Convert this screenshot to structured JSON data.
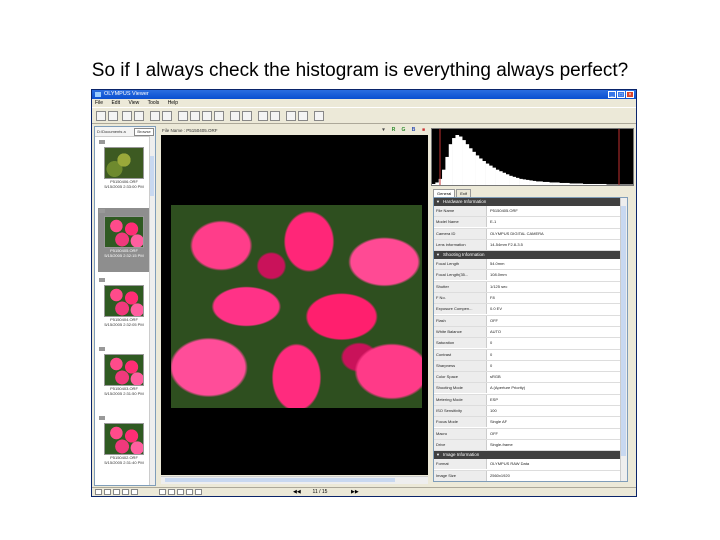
{
  "slide": {
    "title": "So if I always check the histogram is everything always perfect?"
  },
  "window": {
    "title": "OLYMPUS Viewer",
    "controls": [
      "_",
      "□",
      "×"
    ]
  },
  "menu": [
    "File",
    "Edit",
    "View",
    "Tools",
    "Help"
  ],
  "left_panel": {
    "path": "D:\\Documents a",
    "browse_label": "Browse",
    "thumbnails": [
      {
        "name": "P5150406.ORF",
        "date": "5/15/2005 2:33:00 PM",
        "image": "green",
        "selected": false
      },
      {
        "name": "P5150405.ORF",
        "date": "5/15/2005 2:32:15 PM",
        "image": "flower",
        "selected": true
      },
      {
        "name": "P5150404.ORF",
        "date": "5/15/2005 2:32:05 PM",
        "image": "flower",
        "selected": false
      },
      {
        "name": "P5150403.ORF",
        "date": "5/15/2005 2:31:50 PM",
        "image": "flower",
        "selected": false
      },
      {
        "name": "P5150402.ORF",
        "date": "5/15/2005 2:31:40 PM",
        "image": "flower",
        "selected": false
      }
    ]
  },
  "center": {
    "file_label": "File Name : P5150405.ORF",
    "pager": "11 / 15"
  },
  "right_panel": {
    "tabs": [
      "General",
      "Exif"
    ],
    "sections": [
      {
        "title": "Hardware Information",
        "rows": [
          {
            "k": "File Name",
            "v": "P5150405.ORF"
          },
          {
            "k": "Model Name",
            "v": "E-1"
          },
          {
            "k": "Camera ID",
            "v": "OLYMPUS DIGITAL CAMERA"
          },
          {
            "k": "Lens information",
            "v": "14-54mm F2.8-3.5"
          }
        ]
      },
      {
        "title": "Shooting Information",
        "rows": [
          {
            "k": "Focal Length",
            "v": "54.0mm"
          },
          {
            "k": "Focal Length(35...",
            "v": "108.0mm"
          },
          {
            "k": "Shutter",
            "v": "1/125 sec"
          },
          {
            "k": "F No.",
            "v": "F8"
          },
          {
            "k": "Exposure Compen...",
            "v": "0.0 EV"
          },
          {
            "k": "Flash",
            "v": "OFF"
          },
          {
            "k": "White Balance",
            "v": "AUTO"
          },
          {
            "k": "Saturation",
            "v": "0"
          },
          {
            "k": "Contrast",
            "v": "0"
          },
          {
            "k": "Sharpness",
            "v": "0"
          },
          {
            "k": "Color Space",
            "v": "sRGB"
          },
          {
            "k": "Shooting Mode",
            "v": "A (Aperture Priority)"
          },
          {
            "k": "Metering Mode",
            "v": "ESP"
          },
          {
            "k": "ISO Sensitivity",
            "v": "100"
          },
          {
            "k": "Focus Mode",
            "v": "Single AF"
          },
          {
            "k": "Macro",
            "v": "OFF"
          },
          {
            "k": "Drive",
            "v": "Single-frame"
          }
        ]
      },
      {
        "title": "Image Information",
        "rows": [
          {
            "k": "Format",
            "v": "OLYMPUS RAW Data"
          },
          {
            "k": "Image Size",
            "v": "2560x1920"
          },
          {
            "k": "Color Depth",
            "v": "16.7 million colors"
          }
        ]
      }
    ]
  },
  "histogram": {
    "values": [
      2,
      5,
      12,
      30,
      55,
      80,
      92,
      98,
      95,
      88,
      80,
      72,
      65,
      58,
      52,
      47,
      42,
      38,
      34,
      30,
      27,
      24,
      21,
      18,
      16,
      14,
      12,
      11,
      10,
      9,
      8,
      7,
      7,
      6,
      6,
      5,
      5,
      5,
      4,
      4,
      4,
      3,
      3,
      3,
      3,
      2,
      2,
      2,
      2,
      2,
      2,
      2,
      1,
      1,
      1,
      1,
      1,
      1,
      1,
      1
    ]
  },
  "colors": {
    "titlebar": "#0a4fd0",
    "photo_pink": "#ff2d75",
    "leaf_green": "#2e4f1f"
  }
}
